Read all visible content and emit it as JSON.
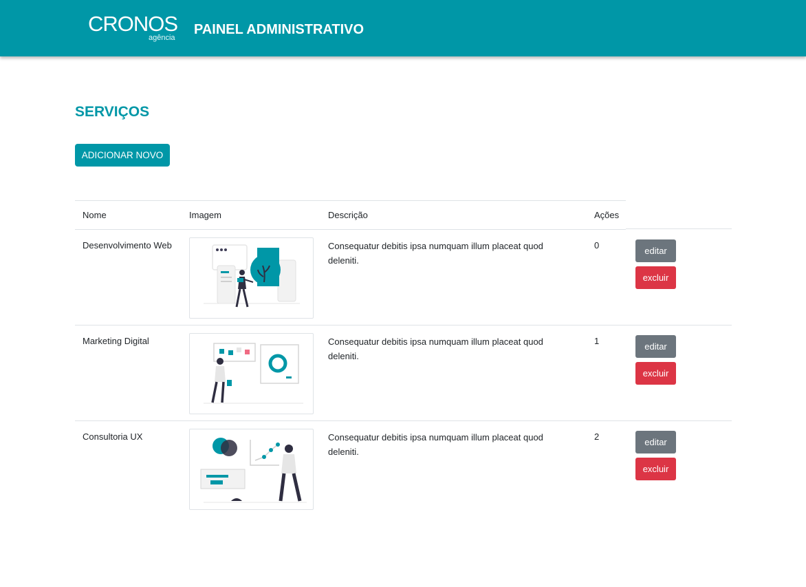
{
  "header": {
    "logo_text": "CRONOS",
    "logo_sub": "agência",
    "title": "PAINEL ADMINISTRATIVO"
  },
  "section": {
    "title": "SERVIÇOS",
    "add_button": "ADICIONAR NOVO"
  },
  "table": {
    "columns": [
      "Nome",
      "Imagem",
      "Descrição",
      "Ações"
    ],
    "rows": [
      {
        "name": "Desenvolvimento Web",
        "image_icon": "web-development-illustration-icon",
        "description": "Consequatur debitis ipsa numquam illum placeat quod deleniti.",
        "order": "0",
        "edit_label": "editar",
        "delete_label": "excluir"
      },
      {
        "name": "Marketing Digital",
        "image_icon": "digital-marketing-illustration-icon",
        "description": "Consequatur debitis ipsa numquam illum placeat quod deleniti.",
        "order": "1",
        "edit_label": "editar",
        "delete_label": "excluir"
      },
      {
        "name": "Consultoria UX",
        "image_icon": "ux-consulting-illustration-icon",
        "description": "Consequatur debitis ipsa numquam illum placeat quod deleniti.",
        "order": "2",
        "edit_label": "editar",
        "delete_label": "excluir"
      }
    ]
  },
  "colors": {
    "brand": "#0097a7",
    "edit_button": "#6c757d",
    "delete_button": "#dc3545",
    "illustration_dark": "#2f2e41",
    "illustration_accent": "#0097a7",
    "illustration_pink": "#f06b83"
  }
}
